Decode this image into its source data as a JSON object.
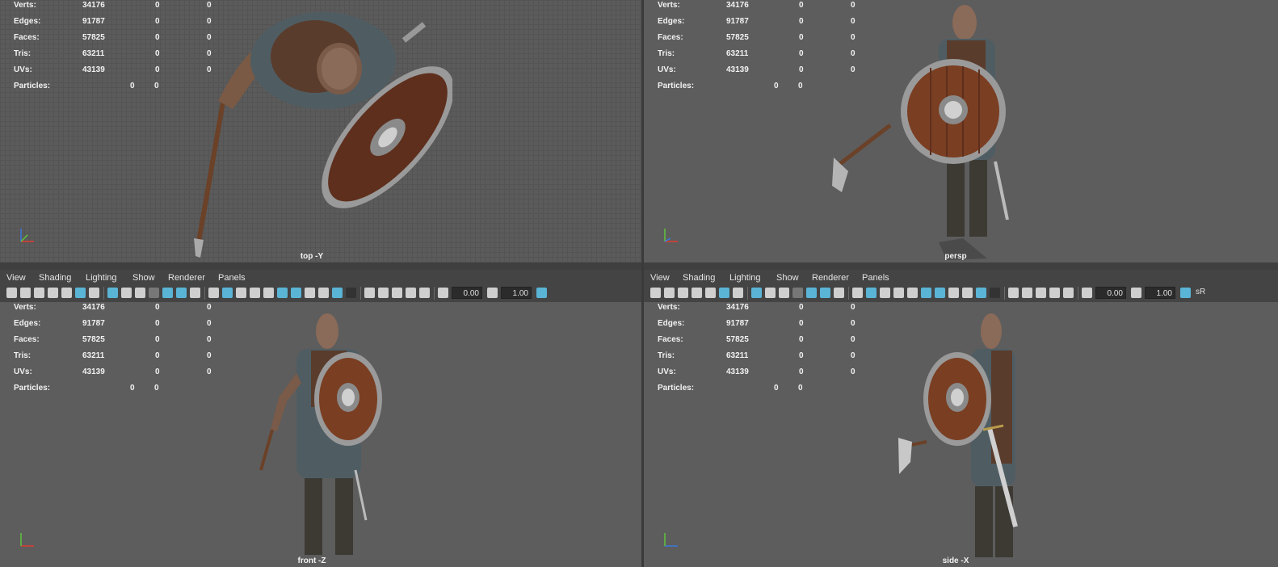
{
  "stats": {
    "labels": [
      "Verts:",
      "Edges:",
      "Faces:",
      "Tris:",
      "UVs:",
      "Particles:"
    ],
    "values": [
      [
        "34176",
        "0",
        "0"
      ],
      [
        "91787",
        "0",
        "0"
      ],
      [
        "57825",
        "0",
        "0"
      ],
      [
        "63211",
        "0",
        "0"
      ],
      [
        "43139",
        "0",
        "0"
      ],
      [
        "0",
        "0"
      ]
    ]
  },
  "viewports": [
    {
      "name": "top -Y"
    },
    {
      "name": "persp"
    },
    {
      "name": "front -Z"
    },
    {
      "name": "side -X"
    }
  ],
  "menu": [
    "View",
    "Shading",
    "Lighting",
    "Show",
    "Renderer",
    "Panels"
  ],
  "toolbar": {
    "exposure": "0.00",
    "gamma": "1.00",
    "color_space_left": "",
    "color_space_right": "sR"
  },
  "icons": [
    "camera-icon",
    "select-camera-icon",
    "lock-camera-icon",
    "bookmark-icon",
    "image-plane-icon",
    "2d-pan-icon",
    "grease-pencil-icon",
    "grid-icon",
    "film-gate-icon",
    "resolution-gate-icon",
    "gate-mask-icon",
    "field-chart-icon",
    "safe-action-icon",
    "safe-title-icon",
    "wireframe-icon",
    "smooth-shade-icon",
    "default-material-icon",
    "wireframe-on-shaded-icon",
    "textured-icon",
    "use-all-lights-icon",
    "shadows-icon",
    "screen-space-ao-icon",
    "motion-blur-icon",
    "multisample-aa-icon",
    "depth-of-field-icon",
    "isolate-select-icon",
    "xray-icon",
    "xray-active-components-icon",
    "xray-joints-icon",
    "backface-culling-icon",
    "exposure-icon",
    "gamma-icon",
    "color-management-icon"
  ],
  "colors": {
    "viewport_bg": "#5d5d5d",
    "panel_bg": "#444444",
    "active_icon": "#5ab4d6",
    "axis_x": "#e03c31",
    "axis_y": "#5fc43c",
    "axis_z": "#3a78e0"
  }
}
